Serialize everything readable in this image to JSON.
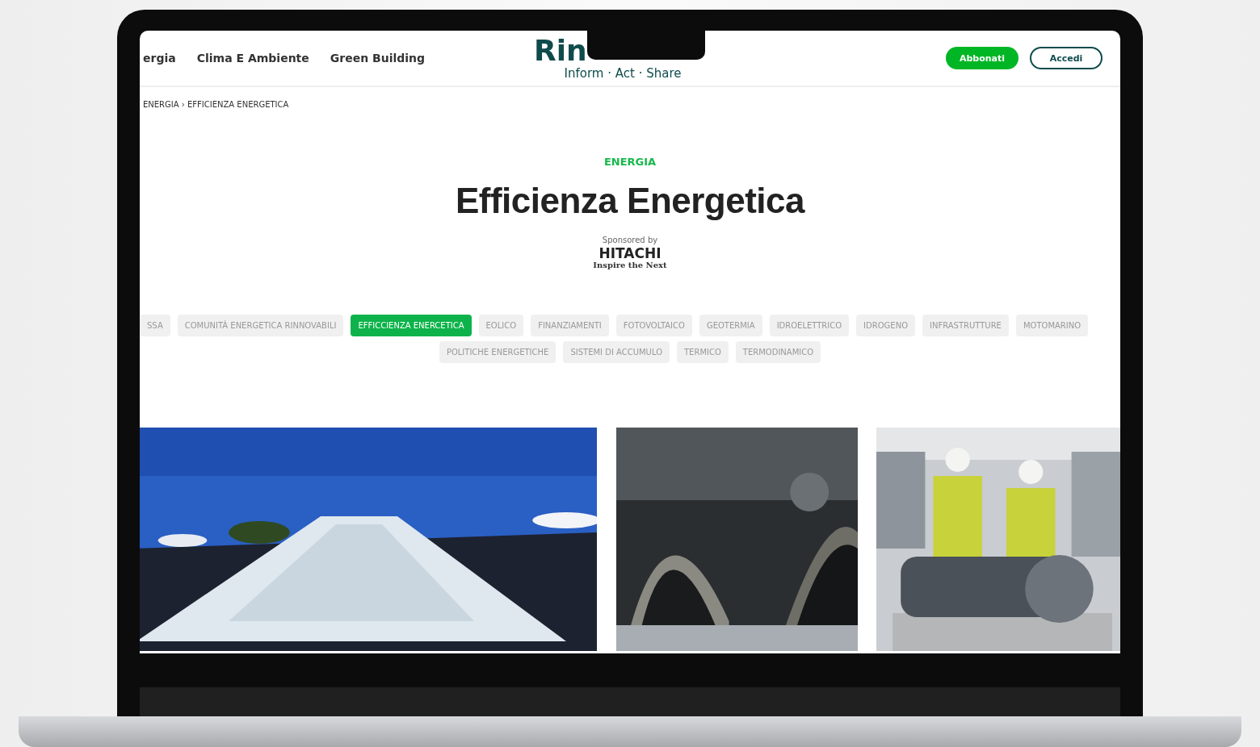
{
  "nav": {
    "items": [
      {
        "label": "ergia"
      },
      {
        "label": "Clima E Ambiente"
      },
      {
        "label": "Green Building"
      }
    ],
    "logo": "Rin",
    "tagline": "Inform · Act · Share",
    "buttons": [
      {
        "label": "Abbonati",
        "kind": "filled"
      },
      {
        "label": "Accedi",
        "kind": "outline"
      }
    ]
  },
  "breadcrumb": "ENERGIA › EFFICIENZA ENERGETICA",
  "category": "ENERGIA",
  "title": "Efficienza Energetica",
  "sponsor": {
    "label": "Sponsored by",
    "name": "HITACHI",
    "slogan": "Inspire the Next"
  },
  "tags": [
    [
      {
        "label": "SSA",
        "selected": false
      },
      {
        "label": "COMUNITÀ ENERGETICA RINNOVABILI",
        "selected": false
      },
      {
        "label": "EFFICCIENZA ENERCETICA",
        "selected": true
      },
      {
        "label": "EOLICO",
        "selected": false
      },
      {
        "label": "FINANZIAMENTI",
        "selected": false
      },
      {
        "label": "FOTOVOLTAICO",
        "selected": false
      },
      {
        "label": "GEOTERMIA",
        "selected": false
      },
      {
        "label": "IDROELETTRICO",
        "selected": false
      },
      {
        "label": "IDROGENO",
        "selected": false
      },
      {
        "label": "INFRASTRUTTURE",
        "selected": false
      },
      {
        "label": "MOTOMARINO",
        "selected": false
      }
    ],
    [
      {
        "label": "POLITICHE ENERGETICHE",
        "selected": false
      },
      {
        "label": "SISTEMI DI ACCUMULO",
        "selected": false
      },
      {
        "label": "TERMICO",
        "selected": false
      },
      {
        "label": "TERMODINAMICO",
        "selected": false
      }
    ]
  ]
}
